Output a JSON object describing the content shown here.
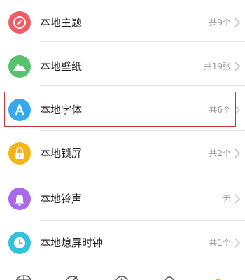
{
  "colors": {
    "theme_icon": "#f15b66",
    "wallpaper_icon": "#56c26d",
    "font_icon": "#35a9ef",
    "lockscreen_icon": "#f5b316",
    "ringtone_icon": "#a86ae8",
    "clock_icon": "#32c2dc",
    "highlight_border": "#c8353d",
    "active_tab": "#f5a623"
  },
  "list": {
    "items": [
      {
        "label": "本地主题",
        "count": "共9个",
        "icon": "compass-icon"
      },
      {
        "label": "本地壁纸",
        "count": "共19张",
        "icon": "mountain-icon"
      },
      {
        "label": "本地字体",
        "count": "共6个",
        "icon": "letter-a-icon"
      },
      {
        "label": "本地锁屏",
        "count": "共2个",
        "icon": "lock-icon"
      },
      {
        "label": "本地铃声",
        "count": "无",
        "icon": "bell-icon"
      },
      {
        "label": "本地熄屏时钟",
        "count": "共1个",
        "icon": "clock-icon"
      }
    ]
  },
  "tabbar": {
    "tabs": [
      {
        "icon": "globe-icon"
      },
      {
        "icon": "brush-icon"
      },
      {
        "icon": "font-tab-icon"
      },
      {
        "icon": "search-icon"
      },
      {
        "icon": "profile-icon"
      }
    ]
  }
}
